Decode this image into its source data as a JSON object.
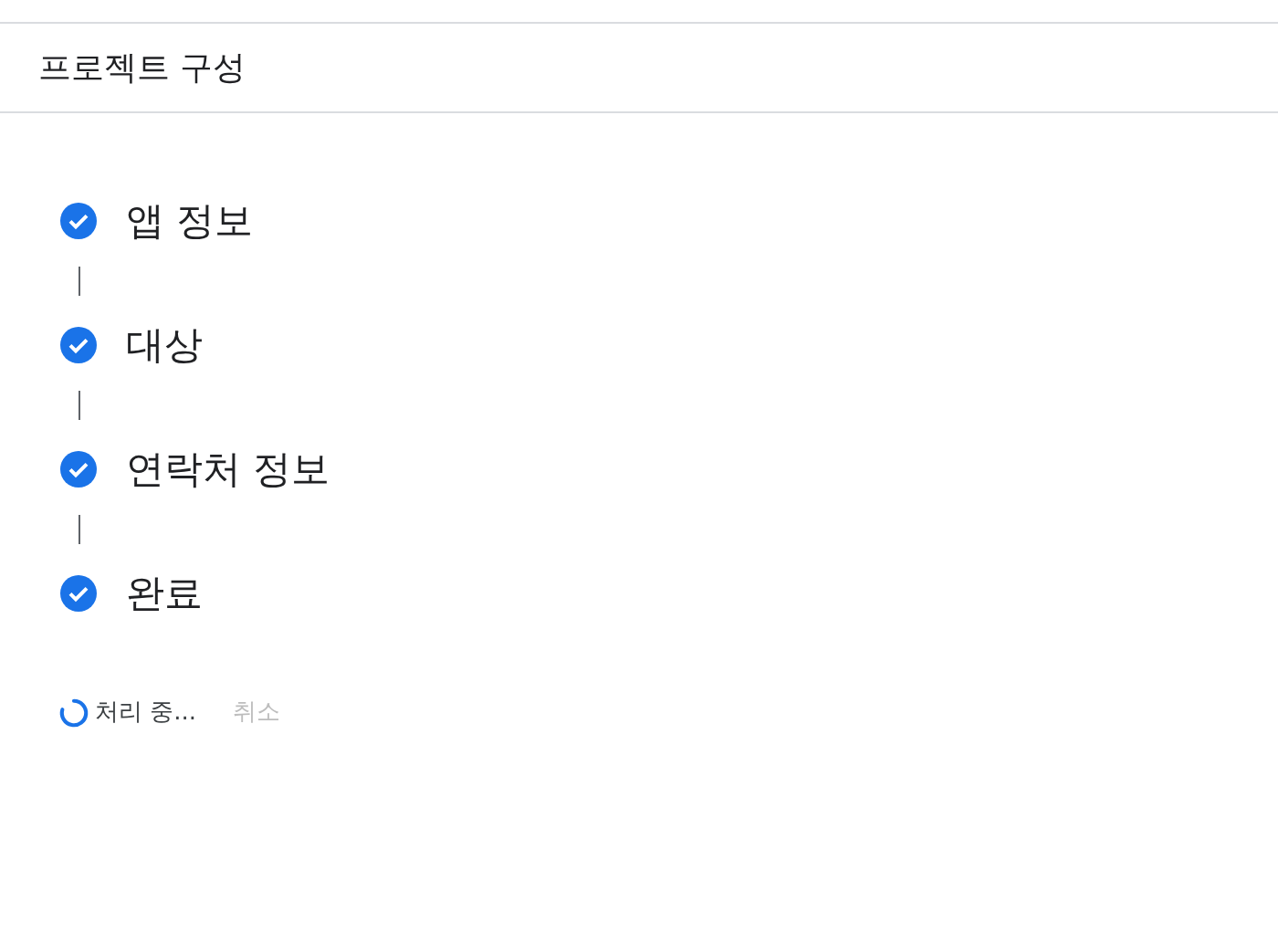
{
  "header": {
    "title": "프로젝트 구성"
  },
  "steps": [
    {
      "label": "앱 정보",
      "done": true
    },
    {
      "label": "대상",
      "done": true
    },
    {
      "label": "연락처 정보",
      "done": true
    },
    {
      "label": "완료",
      "done": true
    }
  ],
  "status": {
    "text": "처리 중...",
    "cancel": "취소",
    "cancel_disabled": true
  }
}
